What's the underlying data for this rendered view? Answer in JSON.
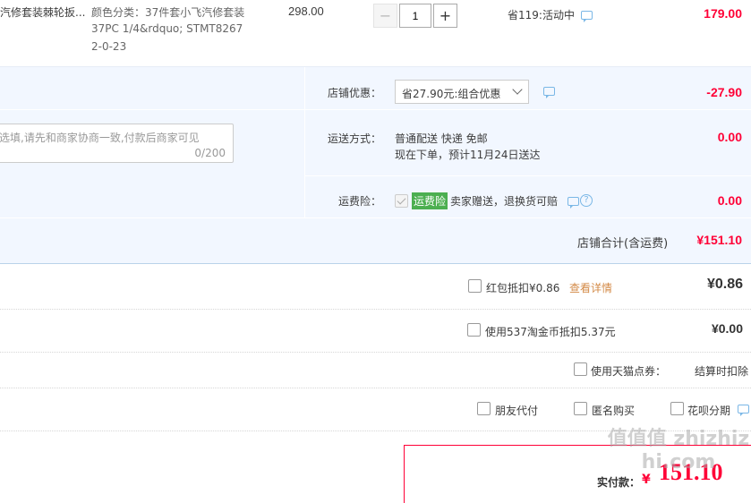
{
  "item": {
    "title": "汽修套装棘轮扳...",
    "sku_line1": "颜色分类：37件套小飞汽修套装",
    "sku_line2": "37PC 1/4&rdquo; STMT8267",
    "sku_line3": "2-0-23",
    "price": "298.00",
    "quantity": "1",
    "decrease_label": "−",
    "increase_label": "+",
    "promo_note": "省119:活动中",
    "subtotal": "179.00"
  },
  "store": {
    "discount_label": "店铺优惠：",
    "discount_value": "省27.90元:组合优惠",
    "discount_amount": "-27.90",
    "message_placeholder": "选填,请先和商家协商一致,付款后商家可见",
    "message_counter": "0/200",
    "shipping_label": "运送方式：",
    "shipping_line1": "普通配送 快递 免邮",
    "shipping_line2": "现在下单，预计11月24日送达",
    "shipping_amount": "0.00",
    "insurance_label": "运费险：",
    "insurance_badge": "运费险",
    "insurance_text": "卖家赠送，退换货可赔",
    "insurance_amount": "0.00",
    "total_label": "店铺合计(含运费)",
    "total_value": "¥151.10"
  },
  "options": {
    "redpacket_label": "红包抵扣¥0.86",
    "redpacket_link": "查看详情",
    "redpacket_amount": "¥0.86",
    "taojinbi_label": "使用537淘金币抵扣5.37元",
    "taojinbi_amount": "¥0.00",
    "tmall_points_label": "使用天猫点券：",
    "tmall_points_note": "结算时扣除",
    "friend_pay_label": "朋友代付",
    "anonymous_label": "匿名购买",
    "huabei_label": "花呗分期"
  },
  "summary": {
    "pay_label": "实付款：",
    "currency": "¥",
    "pay_value": "151.10"
  },
  "watermark": "值值值 zhizhizhi.com",
  "colors": {
    "accent_red": "#ff0036",
    "panel_bg": "#f2f7ff",
    "badge_green": "#4caf50",
    "link_orange": "#d38a47"
  }
}
